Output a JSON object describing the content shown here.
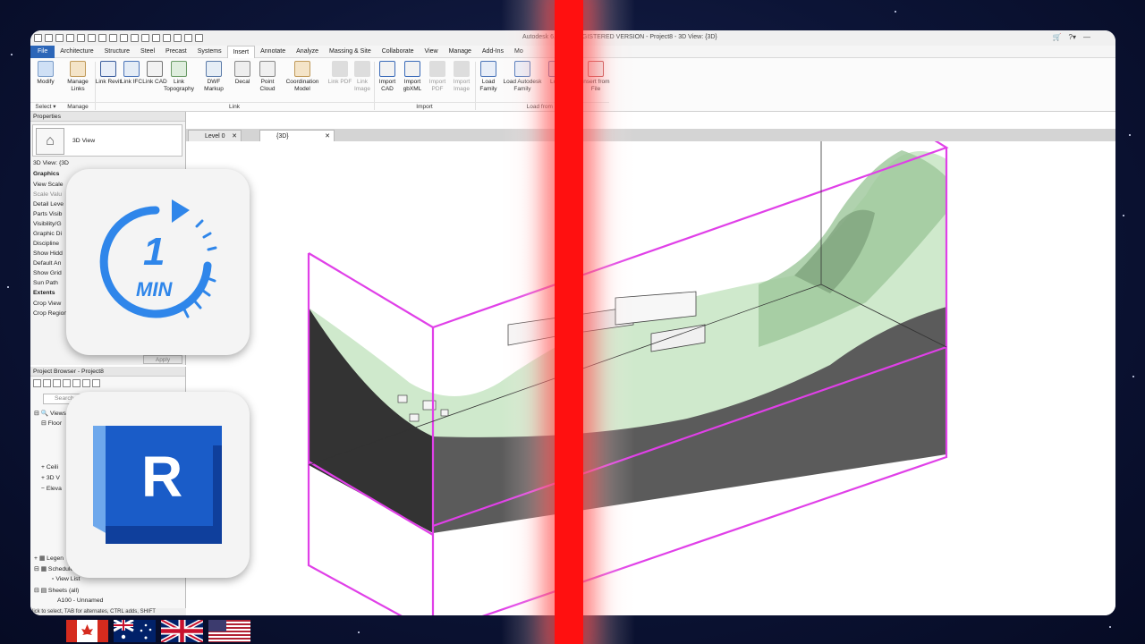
{
  "window": {
    "title": "Autodesk        6.1 - UNREGISTERED VERSION - Project8 - 3D View: {3D}"
  },
  "menu_tabs": [
    "File",
    "Architecture",
    "Structure",
    "Steel",
    "Precast",
    "Systems",
    "Insert",
    "Annotate",
    "Analyze",
    "Massing & Site",
    "Collaborate",
    "View",
    "Manage",
    "Add-Ins",
    "Mo"
  ],
  "active_tab": "Insert",
  "ribbon": {
    "modify": "Modify",
    "manage_links": "Manage Links",
    "link_revit": "Link Revit",
    "link_ifc": "Link IFC",
    "link_cad": "Link CAD",
    "link_topography": "Link Topography",
    "dwf_markup": "DWF Markup",
    "decal": "Decal",
    "point_cloud": "Point Cloud",
    "coordination_model": "Coordination Model",
    "link_pdf": "Link PDF",
    "link_image": "Link Image",
    "import_cad": "Import CAD",
    "import_gbxml": "Import gbXML",
    "import_pdf": "Import PDF",
    "import_image": "Import Image",
    "load_family": "Load Family",
    "load_autodesk_family": "Load Autodesk Family",
    "load_as_group": "Lo G",
    "insert_from_file": "Insert from File",
    "groups": {
      "select": "Select",
      "manage": "Manage",
      "link": "Link",
      "import": "Import",
      "load_from_library": "Load from L"
    }
  },
  "properties": {
    "header": "Properties",
    "type_name": "3D View",
    "instance": "3D View: {3D",
    "rows": [
      "Graphics",
      "View Scale",
      "Scale Valu",
      "Detail Leve",
      "Parts Visib",
      "Visibility/G",
      "Graphic Di",
      "Discipline",
      "Show Hidd",
      "Default An",
      "Show Grid",
      "Sun Path",
      "Extents",
      "Crop View",
      "Crop Region Vis"
    ],
    "apply": "Apply"
  },
  "project_browser": {
    "header": "Project Browser - Project8",
    "search_placeholder": "Search",
    "rows": [
      "Views",
      "Floor",
      "Ceili",
      "3D V",
      "Eleva",
      "Legen",
      "Schedule",
      "View List",
      "Sheets (all)",
      "A100 - Unnamed"
    ]
  },
  "status_bar": "lick to select, TAB for alternates, CTRL adds, SHIFT",
  "view_tabs": [
    "Level 0",
    "{3D}"
  ],
  "badge": {
    "number": "1",
    "unit": "MIN",
    "logo_letter": "R"
  }
}
